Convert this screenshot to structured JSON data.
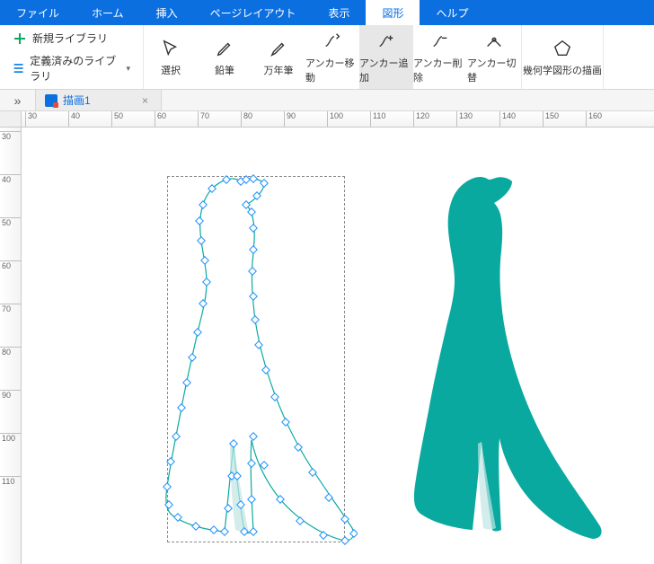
{
  "menu": {
    "file": "ファイル",
    "home": "ホーム",
    "insert": "挿入",
    "pageLayout": "ページレイアウト",
    "view": "表示",
    "shape": "図形",
    "help": "ヘルプ"
  },
  "ribbon": {
    "newLibrary": "新規ライブラリ",
    "definedLibrary": "定義済みのライブラリ",
    "select": "選択",
    "pencil": "鉛筆",
    "fountainPen": "万年筆",
    "anchorMove": "アンカー移動",
    "anchorAdd": "アンカー追加",
    "anchorDelete": "アンカー削除",
    "anchorToggle": "アンカー切替",
    "geometryDraw": "幾何学図形の描画"
  },
  "tab": {
    "name": "描画1"
  },
  "ruler": {
    "h": [
      "30",
      "40",
      "50",
      "60",
      "70",
      "80",
      "90",
      "100",
      "110",
      "120",
      "130",
      "140",
      "150",
      "160"
    ],
    "v": [
      "30",
      "40",
      "50",
      "60",
      "70",
      "80",
      "90",
      "100",
      "110"
    ]
  },
  "colors": {
    "accent": "#0b6fe0",
    "shape": "#0aa9a0"
  }
}
